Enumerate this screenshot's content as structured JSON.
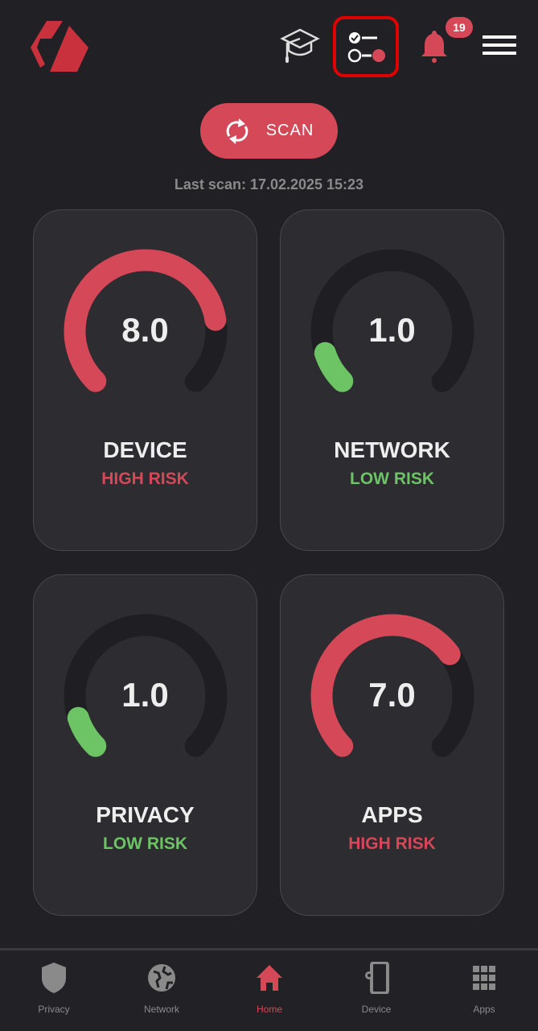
{
  "header": {
    "notification_count": "19",
    "icons": [
      "logo",
      "graduation-cap-icon",
      "checklist-toggle-icon",
      "bell-icon",
      "hamburger-menu-icon"
    ]
  },
  "scan": {
    "label": "SCAN",
    "last_scan": "Last scan: 17.02.2025 15:23"
  },
  "colors": {
    "high": "#d44858",
    "low": "#6cc465",
    "track": "#1f1e22",
    "accent": "#d44858"
  },
  "cards": [
    {
      "title": "DEVICE",
      "value": "8.0",
      "score": 8.0,
      "max": 10,
      "risk": "HIGH RISK",
      "level": "high"
    },
    {
      "title": "NETWORK",
      "value": "1.0",
      "score": 1.0,
      "max": 10,
      "risk": "LOW RISK",
      "level": "low"
    },
    {
      "title": "PRIVACY",
      "value": "1.0",
      "score": 1.0,
      "max": 10,
      "risk": "LOW RISK",
      "level": "low"
    },
    {
      "title": "APPS",
      "value": "7.0",
      "score": 7.0,
      "max": 10,
      "risk": "HIGH RISK",
      "level": "high"
    }
  ],
  "nav": [
    {
      "label": "Privacy",
      "icon": "shield-icon"
    },
    {
      "label": "Network",
      "icon": "globe-icon"
    },
    {
      "label": "Home",
      "icon": "home-icon",
      "active": true
    },
    {
      "label": "Device",
      "icon": "device-settings-icon"
    },
    {
      "label": "Apps",
      "icon": "apps-grid-icon"
    }
  ]
}
